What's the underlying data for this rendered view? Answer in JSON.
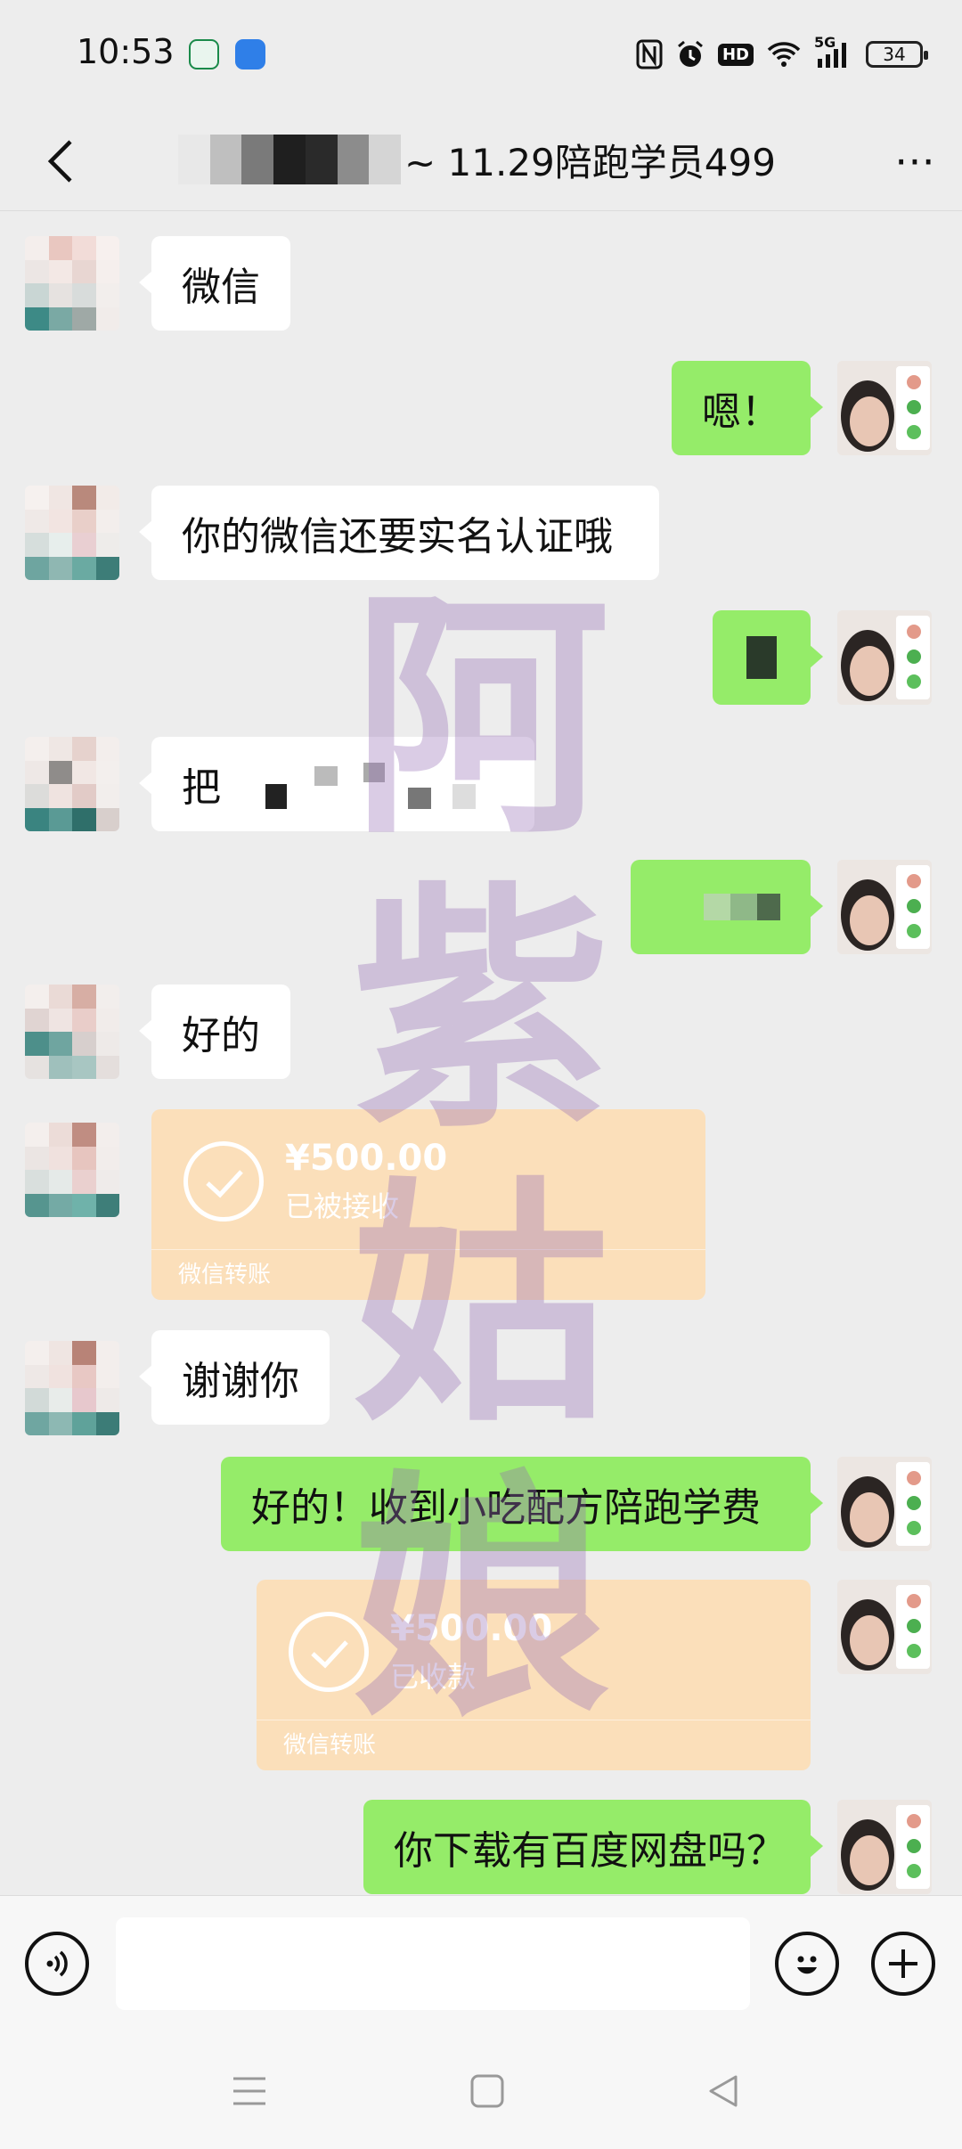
{
  "status_bar": {
    "time": "10:53",
    "battery": "34",
    "icons": [
      "nfc-icon",
      "alarm-icon",
      "hd-icon",
      "wifi-icon",
      "5g-signal-icon",
      "battery-icon"
    ],
    "hd_label": "HD",
    "network_label": "5G"
  },
  "header": {
    "title": "~ 11.29陪跑学员499",
    "back_icon": "chevron-left-icon",
    "more_icon": "more-horizontal-icon"
  },
  "messages": [
    {
      "side": "left",
      "text": "微信"
    },
    {
      "side": "right",
      "text": "嗯！"
    },
    {
      "side": "left",
      "text": "你的微信还要实名认证哦"
    },
    {
      "side": "right",
      "text": ""
    },
    {
      "side": "left",
      "text": "把"
    },
    {
      "side": "right",
      "text": ""
    },
    {
      "side": "left",
      "text": "好的"
    },
    {
      "side": "left",
      "type": "transfer",
      "amount": "¥500.00",
      "status": "已被接收",
      "label": "微信转账"
    },
    {
      "side": "left",
      "text": "谢谢你"
    },
    {
      "side": "right",
      "text": "好的！收到小吃配方陪跑学费"
    },
    {
      "side": "right",
      "type": "transfer",
      "amount": "¥500.00",
      "status": "已收款",
      "label": "微信转账"
    },
    {
      "side": "right",
      "text": "你下载有百度网盘吗？"
    }
  ],
  "watermark": "阿紫姑娘",
  "colors": {
    "background": "#ededed",
    "my_bubble": "#95ec69",
    "their_bubble": "#ffffff",
    "transfer": "#fbdfba"
  }
}
